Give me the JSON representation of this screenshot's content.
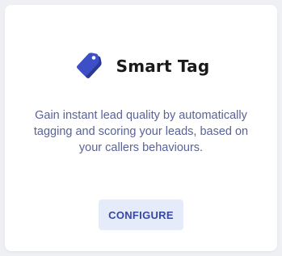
{
  "card": {
    "title": "Smart Tag",
    "icon": "tag-icon",
    "description": "Gain instant lead quality by automatically tagging and scoring your leads, based on your callers behaviours.",
    "button_label": "CONFIGURE"
  },
  "colors": {
    "icon_primary": "#3d4fc7",
    "icon_dark": "#2a3896",
    "button_bg": "#e6ebfa",
    "button_text": "#3548a8",
    "description_text": "#5a6396",
    "title_text": "#1a1a1a"
  }
}
